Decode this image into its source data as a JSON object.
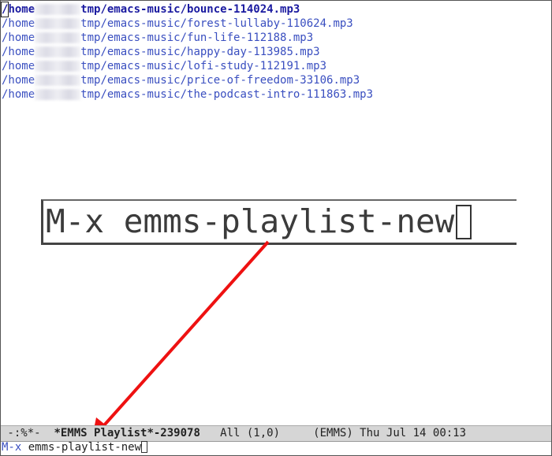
{
  "playlist": {
    "prefix": "/home",
    "tracks": [
      "tmp/emacs-music/bounce-114024.mp3",
      "tmp/emacs-music/forest-lullaby-110624.mp3",
      "tmp/emacs-music/fun-life-112188.mp3",
      "tmp/emacs-music/happy-day-113985.mp3",
      "tmp/emacs-music/lofi-study-112191.mp3",
      "tmp/emacs-music/price-of-freedom-33106.mp3",
      "tmp/emacs-music/the-podcast-intro-111863.mp3"
    ]
  },
  "callout": {
    "text": "M-x emms-playlist-new"
  },
  "modeline": {
    "status": " -:%*-  ",
    "buffer": "*EMMS Playlist*-239078",
    "position": "   All (1,0)     ",
    "mode": "(EMMS)",
    "datetime": " Thu Jul 14 00:13"
  },
  "minibuffer": {
    "prompt": "M-x",
    "input": " emms-playlist-new"
  },
  "colors": {
    "arrow": "#ee1111",
    "link": "#3a4fc0"
  }
}
